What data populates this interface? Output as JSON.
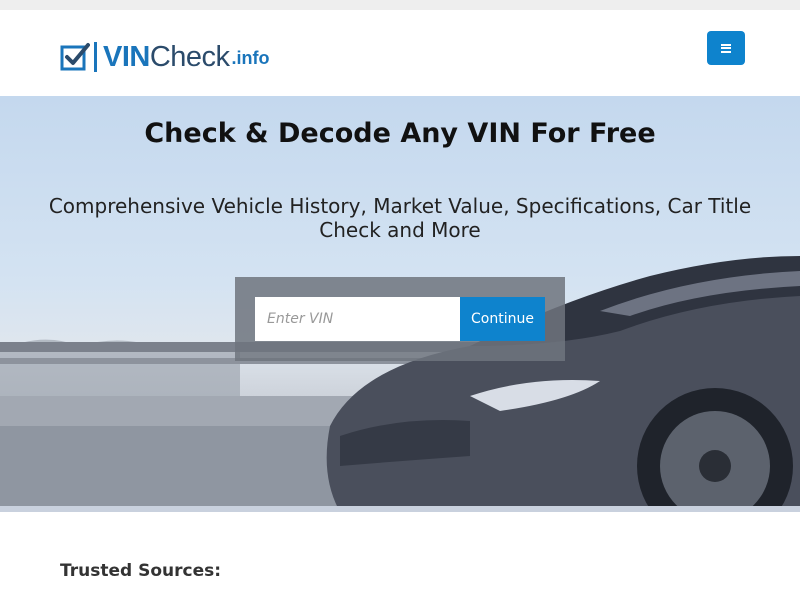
{
  "logo": {
    "vin": "VIN",
    "check": "Check",
    "info": ".info"
  },
  "nav": {
    "menu_icon": "hamburger-icon"
  },
  "hero": {
    "title": "Check & Decode Any VIN For Free",
    "subtitle": "Comprehensive Vehicle History, Market Value, Specifications, Car Title Check and More"
  },
  "search": {
    "placeholder": "Enter VIN",
    "button_label": "Continue"
  },
  "trusted": {
    "heading": "Trusted Sources:"
  },
  "colors": {
    "brand_blue": "#1a75bb",
    "button_blue": "#0e83cd",
    "logo_dark": "#2b4b6b"
  }
}
